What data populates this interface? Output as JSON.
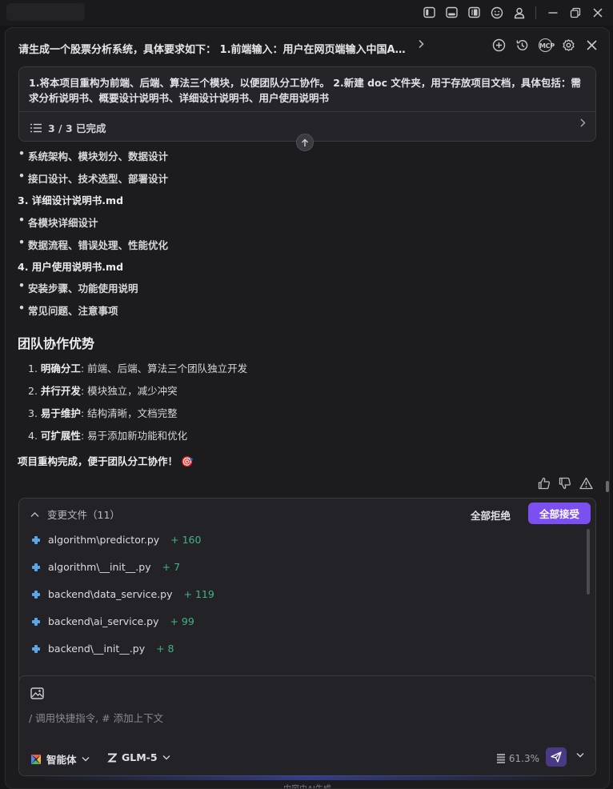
{
  "header": {
    "title": "请生成一个股票分析系统，具体要求如下： 1.前端输入：用户在网页端输入中国A股..."
  },
  "task": {
    "text": "1.将本项目重构为前端、后端、算法三个模块，以便团队分工协作。 2.新建 doc 文件夹，用于存放项目文档，具体包括：需求分析说明书、概要设计说明书、详细设计说明书、用户使用说明书",
    "status": "3 / 3 已完成"
  },
  "content": {
    "design_bullets": [
      "系统架构、模块划分、数据设计",
      "接口设计、技术选型、部署设计"
    ],
    "detail_title": "3. 详细设计说明书.md",
    "detail_bullets": [
      "各模块详细设计",
      "数据流程、错误处理、性能优化"
    ],
    "manual_title": "4. 用户使用说明书.md",
    "manual_bullets": [
      "安装步骤、功能使用说明",
      "常见问题、注意事项"
    ],
    "advantages_heading": "团队协作优势",
    "advantages": [
      {
        "num": "1.",
        "label": "明确分工",
        "text": ": 前端、后端、算法三个团队独立开发"
      },
      {
        "num": "2.",
        "label": "并行开发",
        "text": ": 模块独立，减少冲突"
      },
      {
        "num": "3.",
        "label": "易于维护",
        "text": ": 结构清晰，文档完整"
      },
      {
        "num": "4.",
        "label": "可扩展性",
        "text": ": 易于添加新功能和优化"
      }
    ],
    "final_line": "项目重构完成，便于团队分工协作！",
    "final_emoji": "🎯"
  },
  "changes": {
    "title": "变更文件（11）",
    "reject_label": "全部拒绝",
    "accept_label": "全部接受",
    "files": [
      {
        "path": "algorithm\\predictor.py",
        "adds": "+ 160"
      },
      {
        "path": "algorithm\\__init__.py",
        "adds": "+ 7"
      },
      {
        "path": "backend\\data_service.py",
        "adds": "+ 119"
      },
      {
        "path": "backend\\ai_service.py",
        "adds": "+ 99"
      },
      {
        "path": "backend\\__init__.py",
        "adds": "+ 8"
      }
    ]
  },
  "input": {
    "placeholder": "/ 调用快捷指令, # 添加上下文",
    "agent_label": "智能体",
    "model_label": "GLM-5",
    "context_usage": "61.3%"
  },
  "footer": "内容由AI生成",
  "colors": {
    "accent": "#7b4ff0",
    "additions": "#3fb38a",
    "python_icon": "#5aa6e6"
  }
}
